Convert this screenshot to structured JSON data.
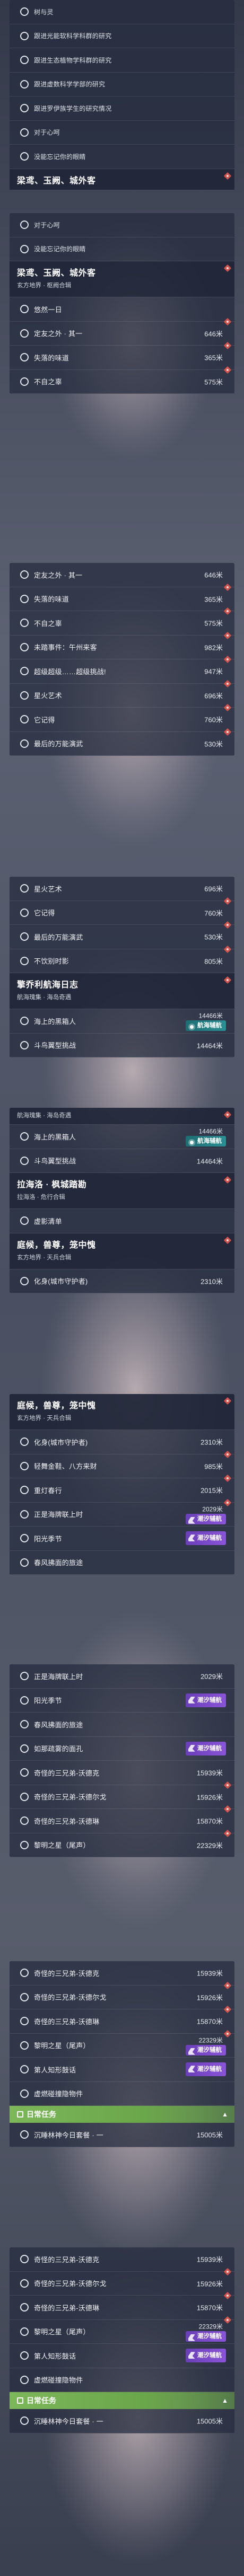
{
  "colors": {
    "accent_red": "#d4524c",
    "badge_purple": "#7a4cc8",
    "badge_teal": "#2a8f93",
    "daily_green": "#76b052"
  },
  "quests": {
    "q1": "树与灵",
    "q2": "跟进光能软科学科群的研究",
    "q3": "跟进生态植物学科群的研究",
    "q4": "跟进虚数科学学部的研究",
    "q5": "跟进罗伊族学生的研究情况",
    "q6": "对于心呵",
    "q7": "没能忘记你的眼睛",
    "q8": "悠然一日",
    "q9": "定友之外 · 其一",
    "q10": "失落的味道",
    "q11": "不自之辜",
    "q12": "未踏事件：午州来客",
    "q13": "超级超级……超级挑战!",
    "q14": "星火艺术",
    "q15": "它记得",
    "q16": "最后的万能演武",
    "q17": "不饮别时影",
    "q18": "海上的黑箱人",
    "q19": "斗鸟翼型挑战",
    "q20": "虚影清单",
    "q21": "化身(城市守护者)",
    "q22": "轻舞金鞋、八方来财",
    "q23": "重灯春行",
    "q24": "正是海牌联上时",
    "q25": "阳光季节",
    "q26": "春风拂面的旅途",
    "q27": "如那疏雾的面孔",
    "q28": "奇怪的三兄弟-沃德克",
    "q29": "奇怪的三兄弟-沃德尔戈",
    "q30": "奇怪的三兄弟-沃德琳",
    "q31": "黎明之星（尾声）",
    "q32": "第人知形鼓话",
    "q33": "虚燃碰撞隐物件",
    "q34": "沉睡林神今日套餐 · 一"
  },
  "dist": {
    "d646": "646米",
    "d365": "365米",
    "d575": "575米",
    "d982": "982米",
    "d947": "947米",
    "d696": "696米",
    "d760": "760米",
    "d530": "530米",
    "d805": "805米",
    "d14466": "14466米",
    "d14464": "14464米",
    "d2310": "2310米",
    "d985": "985米",
    "d2015": "2015米",
    "d2029": "2029米",
    "d15939": "15939米",
    "d15926": "15926米",
    "d15870": "15870米",
    "d22329": "22329米",
    "d15005": "15005米"
  },
  "headers": {
    "h1": {
      "title": "梁鸢、玉阙、城外客"
    },
    "h2": {
      "title": "梁鸢、玉阙、城外客",
      "sub": "玄方地界 · 枢阙合辑"
    },
    "h3": {
      "title": "擎乔利航海日志",
      "sub": "航海瑰集 · 海岛奇遇"
    },
    "h4": {
      "sub": "航海瑰集 · 海岛奇遇"
    },
    "h5": {
      "title": "拉海洛 · 枫城踏勘",
      "sub": "拉海洛 · 危行合辑"
    },
    "h6": {
      "title": "庭候，兽尊，笼中愧",
      "sub": "玄方地界 · 天兵合辑"
    },
    "h7": {
      "title": "庭候，兽尊，笼中愧",
      "sub": "玄方地界 · 天兵合辑"
    }
  },
  "badges": {
    "navigate": "航海辅航",
    "dream": "潮汐辅航"
  },
  "daily": {
    "label": "日常任务",
    "arrow": "▲"
  }
}
